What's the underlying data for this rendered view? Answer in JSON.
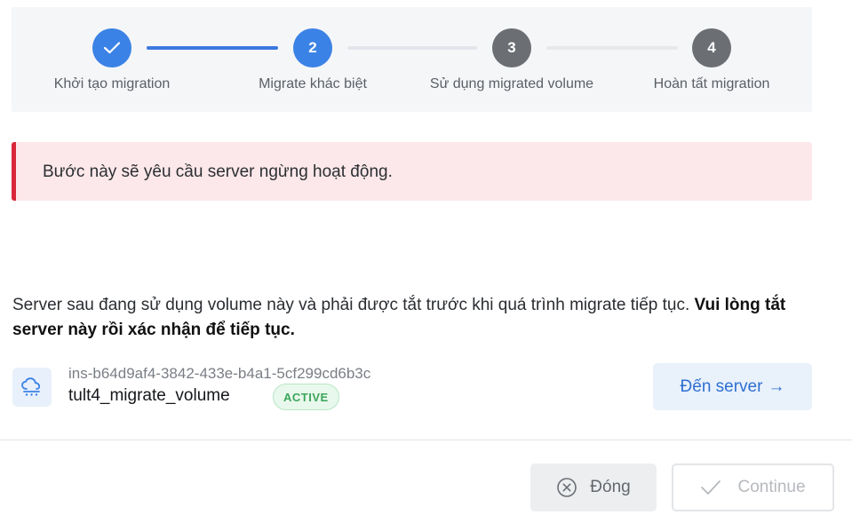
{
  "stepper": {
    "steps": [
      {
        "number": "",
        "label": "Khởi tạo migration",
        "state": "done"
      },
      {
        "number": "2",
        "label": "Migrate khác biệt",
        "state": "current"
      },
      {
        "number": "3",
        "label": "Sử dụng migrated volume",
        "state": "todo"
      },
      {
        "number": "4",
        "label": "Hoàn tất migration",
        "state": "todo"
      }
    ]
  },
  "alert": {
    "message": "Bước này sẽ yêu cầu server ngừng hoạt động."
  },
  "description": {
    "text": "Server sau đang sử dụng volume này và phải được tắt trước khi quá trình migrate tiếp tục. ",
    "bold": "Vui lòng tắt server này rồi xác nhận để tiếp tục."
  },
  "server": {
    "id": "ins-b64d9af4-3842-433e-b4a1-5cf299cd6b3c",
    "name": "tult4_migrate_volume",
    "status": "ACTIVE",
    "goto_label": "Đến server",
    "goto_arrow": "→",
    "icon": "cloud-server-icon"
  },
  "footer": {
    "close_label": "Đóng",
    "continue_label": "Continue"
  },
  "colors": {
    "accent": "#3b82e6",
    "danger": "#d9263a",
    "success": "#3aa65a"
  }
}
